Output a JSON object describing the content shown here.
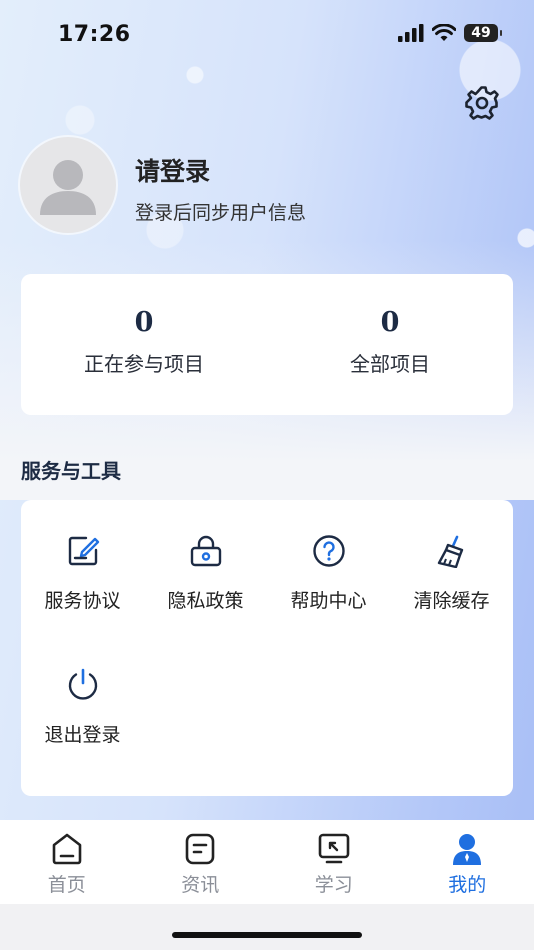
{
  "status_bar": {
    "time": "17:26",
    "battery": "49"
  },
  "profile": {
    "title": "请登录",
    "subtitle": "登录后同步用户信息"
  },
  "stats": [
    {
      "value": "0",
      "label": "正在参与项目"
    },
    {
      "value": "0",
      "label": "全部项目"
    }
  ],
  "services": {
    "title": "服务与工具",
    "items": [
      {
        "label": "服务协议",
        "icon": "edit-document-icon"
      },
      {
        "label": "隐私政策",
        "icon": "lock-icon"
      },
      {
        "label": "帮助中心",
        "icon": "help-icon"
      },
      {
        "label": "清除缓存",
        "icon": "broom-icon"
      },
      {
        "label": "退出登录",
        "icon": "power-icon"
      }
    ]
  },
  "tabbar": {
    "items": [
      {
        "label": "首页",
        "icon": "home-icon"
      },
      {
        "label": "资讯",
        "icon": "news-icon"
      },
      {
        "label": "学习",
        "icon": "study-icon"
      },
      {
        "label": "我的",
        "icon": "user-icon"
      }
    ],
    "active": "我的"
  },
  "colors": {
    "accent": "#1f6fe0",
    "icon_dark": "#1d2b44",
    "tab_inactive": "#8b8f98"
  }
}
